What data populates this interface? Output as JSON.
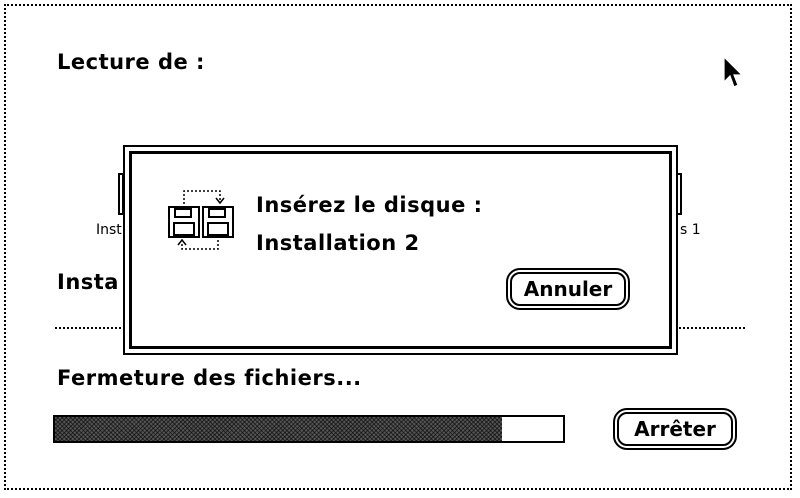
{
  "installer": {
    "reading_from_label": "Lecture de :",
    "hidden_left_text": "Inst",
    "hidden_right_text": "s 1",
    "install_label_partial": "Insta",
    "status_text": "Fermeture des fichiers...",
    "progress_fraction": 0.88,
    "stop_button_label": "Arrêter"
  },
  "dialog": {
    "icon": "floppy-swap-icon",
    "prompt_line1": "Insérez le disque :",
    "prompt_line2": "Installation 2",
    "cancel_button_label": "Annuler"
  },
  "cursor": {
    "icon": "arrow-pointer-icon"
  }
}
